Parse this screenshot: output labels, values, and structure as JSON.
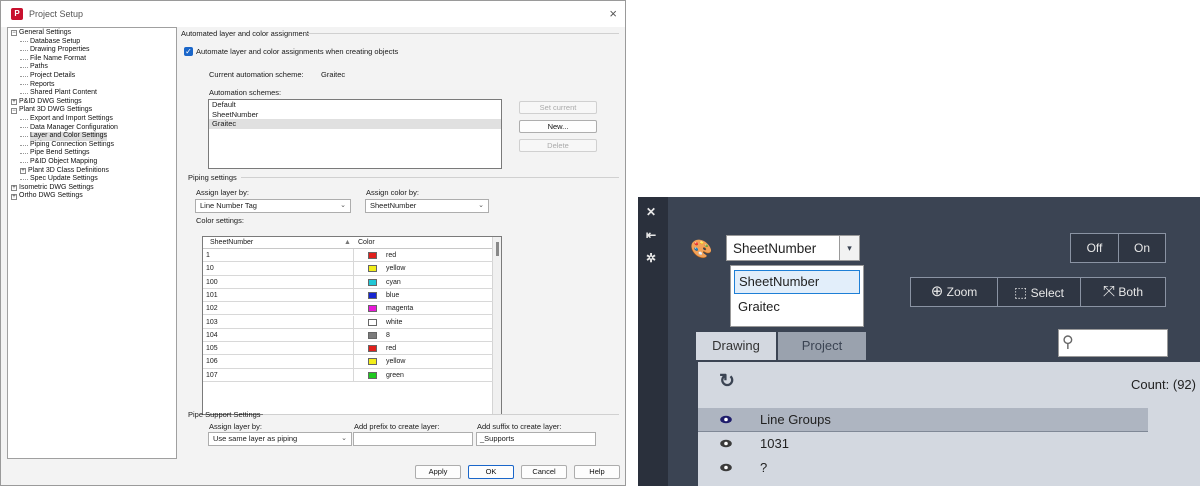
{
  "dialog": {
    "title": "Project Setup",
    "close_glyph": "×",
    "tree": [
      {
        "label": "General Settings",
        "level": 0,
        "expander": "−"
      },
      {
        "label": "Database Setup",
        "level": 1
      },
      {
        "label": "Drawing Properties",
        "level": 1
      },
      {
        "label": "File Name Format",
        "level": 1
      },
      {
        "label": "Paths",
        "level": 1
      },
      {
        "label": "Project Details",
        "level": 1
      },
      {
        "label": "Reports",
        "level": 1
      },
      {
        "label": "Shared Plant Content",
        "level": 1
      },
      {
        "label": "P&ID DWG Settings",
        "level": 0,
        "expander": "+"
      },
      {
        "label": "Plant 3D DWG Settings",
        "level": 0,
        "expander": "−"
      },
      {
        "label": "Export and Import Settings",
        "level": 1
      },
      {
        "label": "Data Manager Configuration",
        "level": 1
      },
      {
        "label": "Layer and Color Settings",
        "level": 1,
        "selected": true
      },
      {
        "label": "Piping Connection Settings",
        "level": 1
      },
      {
        "label": "Pipe Bend Settings",
        "level": 1
      },
      {
        "label": "P&ID Object Mapping",
        "level": 1
      },
      {
        "label": "Plant 3D Class Definitions",
        "level": 1,
        "expander": "+"
      },
      {
        "label": "Spec Update Settings",
        "level": 1
      },
      {
        "label": "Isometric DWG Settings",
        "level": 0,
        "expander": "+"
      },
      {
        "label": "Ortho DWG Settings",
        "level": 0,
        "expander": "+"
      }
    ],
    "auto": {
      "group_label": "Automated layer and color assignment",
      "checkbox_label": "Automate layer and color assignments when creating objects",
      "checked": true,
      "current_label": "Current automation scheme:",
      "current_value": "Graitec",
      "schemes_label": "Automation schemes:",
      "schemes": [
        "Default",
        "SheetNumber",
        "Graitec"
      ],
      "selected_scheme": "Graitec",
      "set_current": "Set current",
      "new": "New...",
      "delete": "Delete"
    },
    "piping": {
      "group_label": "Piping settings",
      "assign_layer_label": "Assign layer by:",
      "assign_layer_value": "Line Number Tag",
      "assign_color_label": "Assign color by:",
      "assign_color_value": "SheetNumber",
      "color_settings_label": "Color settings:",
      "columns": [
        "SheetNumber",
        "Color"
      ],
      "sort_glyph": "▲",
      "rows": [
        {
          "key": "1",
          "color": "red",
          "hex": "#e0201c"
        },
        {
          "key": "10",
          "color": "yellow",
          "hex": "#f2ee1a"
        },
        {
          "key": "100",
          "color": "cyan",
          "hex": "#21c7d6"
        },
        {
          "key": "101",
          "color": "blue",
          "hex": "#1726d0"
        },
        {
          "key": "102",
          "color": "magenta",
          "hex": "#e81ad8"
        },
        {
          "key": "103",
          "color": "white",
          "hex": "#ffffff"
        },
        {
          "key": "104",
          "color": "8",
          "hex": "#7b7b7b"
        },
        {
          "key": "105",
          "color": "red",
          "hex": "#e0201c"
        },
        {
          "key": "106",
          "color": "yellow",
          "hex": "#f2ee1a"
        },
        {
          "key": "107",
          "color": "green",
          "hex": "#1fc91f"
        }
      ]
    },
    "support": {
      "group_label": "Pipe Support Settings",
      "assign_layer_label": "Assign layer by:",
      "assign_layer_value": "Use same layer as piping",
      "prefix_label": "Add prefix to create layer:",
      "prefix_value": "",
      "suffix_label": "Add suffix to create layer:",
      "suffix_value": "_Supports"
    },
    "buttons": {
      "apply": "Apply",
      "ok": "OK",
      "cancel": "Cancel",
      "help": "Help"
    }
  },
  "palette": {
    "strip_icons": [
      "close-icon",
      "pin-icon",
      "settings-icon"
    ],
    "strip_glyphs": [
      "✕",
      "⇤",
      "✲"
    ],
    "icon_glyph": "🎨",
    "scheme_value": "SheetNumber",
    "dropdown_glyph": "▾",
    "dropdown_options": [
      "SheetNumber",
      "Graitec"
    ],
    "highlighted_option": "SheetNumber",
    "toggle": {
      "off": "Off",
      "on": "On"
    },
    "zoom_bar": {
      "zoom": "Zoom",
      "select": "Select",
      "both": "Both",
      "zoom_glyph": "⊕",
      "select_glyph": "⬚",
      "both_glyph": "⤧"
    },
    "tabs": [
      {
        "label": "Drawing",
        "active": true
      },
      {
        "label": "Project",
        "active": false
      }
    ],
    "search_placeholder": "",
    "search_glyph": "⚲",
    "refresh_glyph": "↻",
    "count_label": "Count: (92)",
    "rows": [
      {
        "label": "Line Groups",
        "header": true
      },
      {
        "label": "1031",
        "header": false
      },
      {
        "label": "?",
        "header": false
      }
    ]
  }
}
